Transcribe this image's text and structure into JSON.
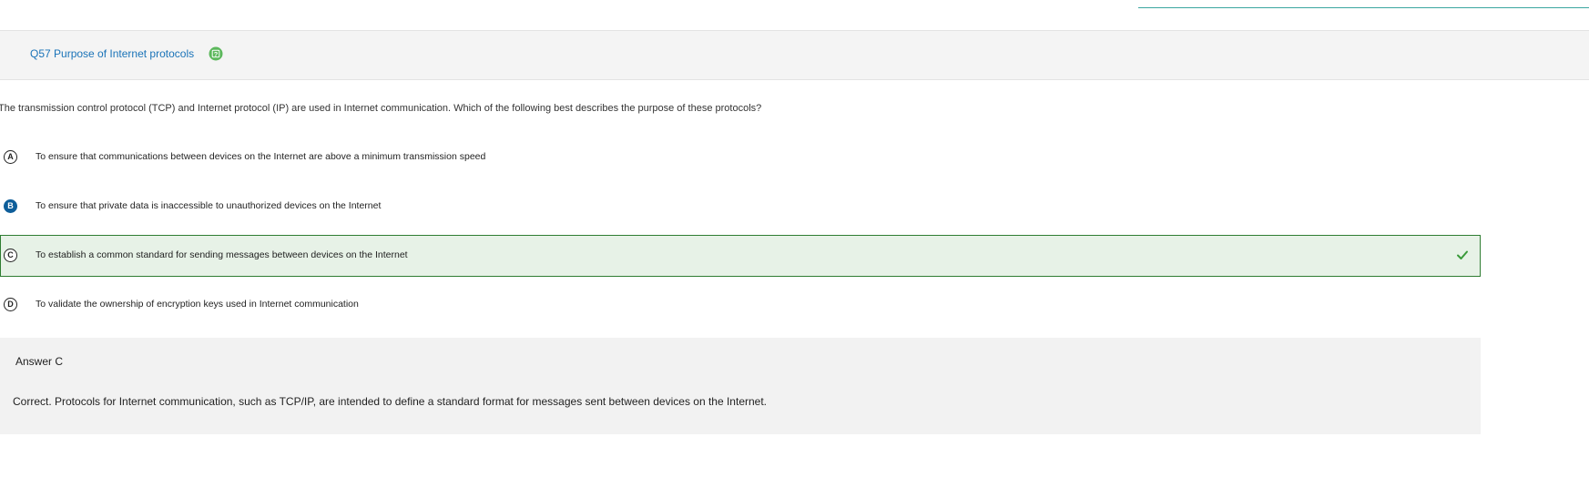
{
  "question": {
    "title": "Q57 Purpose of Internet protocols",
    "help_icon": "help-icon",
    "text": "The transmission control protocol (TCP) and Internet protocol (IP) are used in Internet communication. Which of the following best describes the purpose of these protocols?"
  },
  "options": [
    {
      "letter": "A",
      "text": "To ensure that communications between devices on the Internet are above a minimum transmission speed"
    },
    {
      "letter": "B",
      "text": "To ensure that private data is inaccessible to unauthorized devices on the Internet"
    },
    {
      "letter": "C",
      "text": "To establish a common standard for sending messages between devices on the Internet"
    },
    {
      "letter": "D",
      "text": "To validate the ownership of encryption keys used in Internet communication"
    }
  ],
  "selected_option": "B",
  "correct_option": "C",
  "answer": {
    "heading": "Answer C",
    "explanation": "Correct. Protocols for Internet communication, such as TCP/IP, are intended to define a standard format for messages sent between devices on the Internet."
  },
  "colors": {
    "title": "#1a73b8",
    "help_icon": "#5cb85c",
    "selected": "#0e5e9a",
    "correct_bg": "#e7f2e7",
    "correct_border": "#2f7d32"
  }
}
